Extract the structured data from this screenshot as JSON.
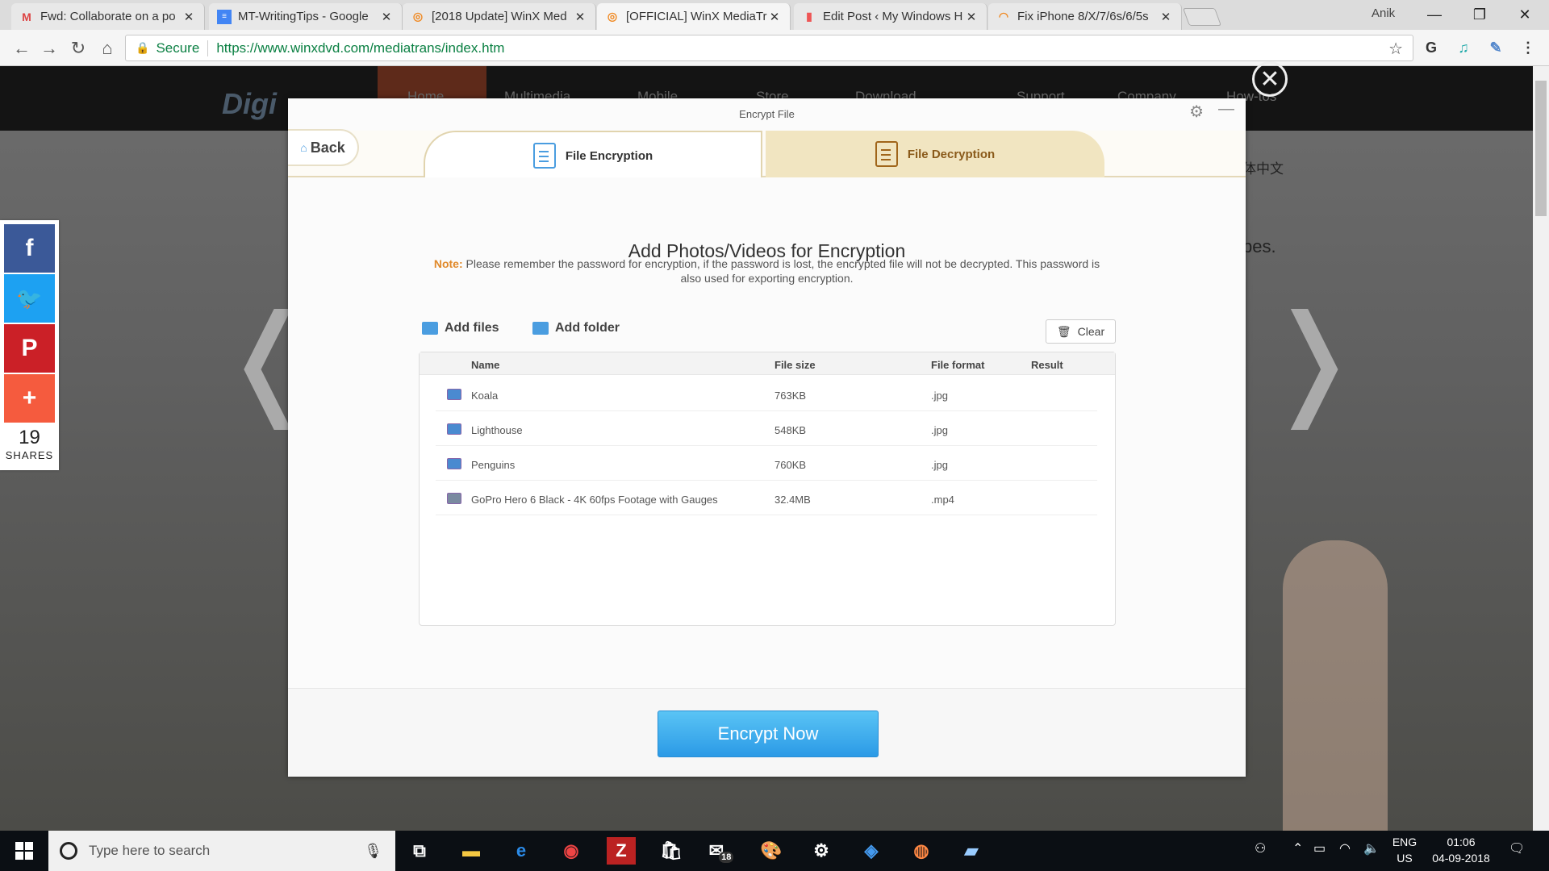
{
  "browser": {
    "tabs": [
      {
        "title": "Fwd: Collaborate on a po",
        "icon": "gmail-icon"
      },
      {
        "title": "MT-WritingTips - Google",
        "icon": "docs-icon"
      },
      {
        "title": "[2018 Update] WinX Med",
        "icon": "winx-icon"
      },
      {
        "title": "[OFFICIAL] WinX MediaTr",
        "icon": "winx-icon"
      },
      {
        "title": "Edit Post ‹ My Windows H",
        "icon": "chart-icon"
      },
      {
        "title": "Fix iPhone 8/X/7/6s/6/5s",
        "icon": "wifi-icon"
      }
    ],
    "user": "Anik",
    "secure_label": "Secure",
    "url": "https://www.winxdvd.com/mediatrans/index.htm"
  },
  "site": {
    "logo": "Digi",
    "nav": [
      "Home",
      "Multimedia",
      "Mobile",
      "Store",
      "Download",
      "Support",
      "Company",
      "How-tos"
    ],
    "chinese_link": "体中文",
    "text_fragment": "pes."
  },
  "share": {
    "count": "19",
    "label": "SHARES"
  },
  "modal": {
    "title": "Encrypt File",
    "back_label": "Back",
    "tab_encryption": "File Encryption",
    "tab_decryption": "File Decryption",
    "heading": "Add Photos/Videos for Encryption",
    "note_label": "Note:",
    "note_text": "Please remember the password for encryption, if the password is lost, the encrypted file will not be decrypted. This password is also used for exporting encryption.",
    "add_files": "Add files",
    "add_folder": "Add folder",
    "clear": "Clear",
    "columns": [
      "Name",
      "File size",
      "File format",
      "Result"
    ],
    "rows": [
      {
        "name": "Koala",
        "size": "763KB",
        "format": ".jpg"
      },
      {
        "name": "Lighthouse",
        "size": "548KB",
        "format": ".jpg"
      },
      {
        "name": "Penguins",
        "size": "760KB",
        "format": ".jpg"
      },
      {
        "name": "GoPro Hero 6 Black - 4K 60fps Footage with Gauges",
        "size": "32.4MB",
        "format": ".mp4"
      }
    ],
    "encrypt_button": "Encrypt Now"
  },
  "taskbar": {
    "search_placeholder": "Type here to search",
    "mail_badge": "18",
    "lang_top": "ENG",
    "lang_bottom": "US",
    "time": "01:06",
    "date": "04-09-2018"
  }
}
